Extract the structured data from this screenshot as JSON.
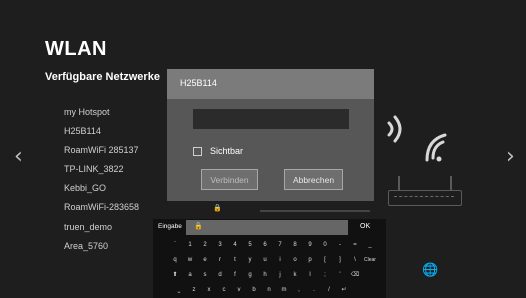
{
  "page": {
    "title": "WLAN",
    "subtitle": "Verfügbare Netzwerke"
  },
  "networks": [
    {
      "name": "my Hotspot"
    },
    {
      "name": "H25B114"
    },
    {
      "name": "RoamWiFi 285137"
    },
    {
      "name": "TP-LINK_3822"
    },
    {
      "name": "Kebbi_GO"
    },
    {
      "name": "RoamWiFi-283658"
    },
    {
      "name": "truen_demo"
    },
    {
      "name": "Area_5760"
    }
  ],
  "nav": {
    "left_arrow": "‹",
    "right_arrow": "›"
  },
  "dialog": {
    "title": "H25B114",
    "password_value": "",
    "show_password_label": "Sichtbar",
    "show_password_checked": false,
    "connect_label": "Verbinden",
    "cancel_label": "Abbrechen"
  },
  "keyboard": {
    "input_label": "Eingabe",
    "ok_label": "OK",
    "rows": [
      [
        "`",
        "1",
        "2",
        "3",
        "4",
        "5",
        "6",
        "7",
        "8",
        "9",
        "0",
        "-",
        "=",
        "_"
      ],
      [
        "q",
        "w",
        "e",
        "r",
        "t",
        "y",
        "u",
        "i",
        "o",
        "p",
        "[",
        "]",
        "\\",
        "Clear"
      ],
      [
        "⬆",
        "a",
        "s",
        "d",
        "f",
        "g",
        "h",
        "j",
        "k",
        "l",
        ";",
        "'",
        "⌫"
      ],
      [
        "⎵",
        "z",
        "x",
        "c",
        "v",
        "b",
        "n",
        "m",
        ",",
        ".",
        "/",
        "↵"
      ]
    ]
  },
  "icons": {
    "lock": "🔒",
    "globe": "🌐"
  }
}
